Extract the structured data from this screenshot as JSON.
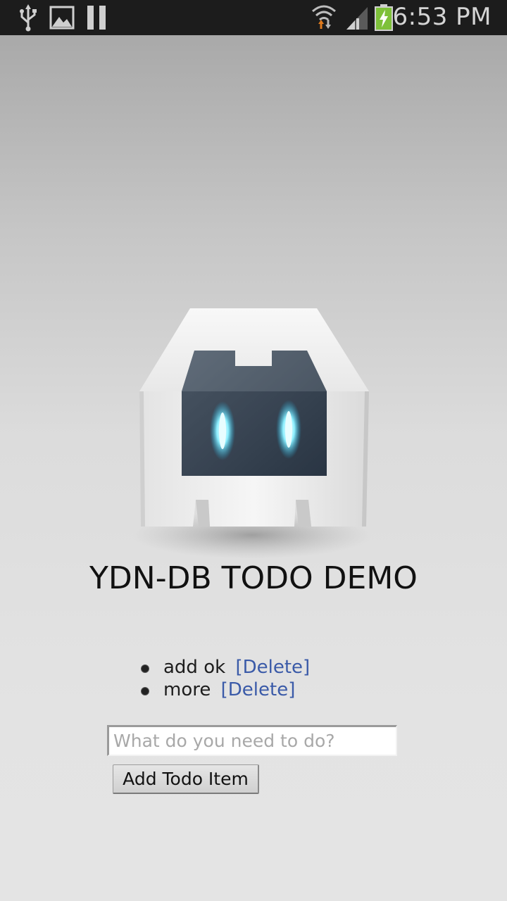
{
  "status_bar": {
    "time": "6:53 PM",
    "icons": [
      "usb-icon",
      "image-icon",
      "pause-icon",
      "wifi-icon",
      "signal-icon",
      "battery-charging-icon"
    ]
  },
  "app": {
    "logo": "cordova-logo",
    "title": "YDN-DB TODO DEMO",
    "todos": [
      {
        "text": "add ok",
        "delete_label": "[Delete]"
      },
      {
        "text": "more",
        "delete_label": "[Delete]"
      }
    ],
    "input": {
      "value": "",
      "placeholder": "What do you need to do?"
    },
    "add_button_label": "Add Todo Item"
  },
  "colors": {
    "status_bar_bg": "#1c1c1c",
    "link": "#3a5aa8",
    "battery": "#7ec13a"
  }
}
